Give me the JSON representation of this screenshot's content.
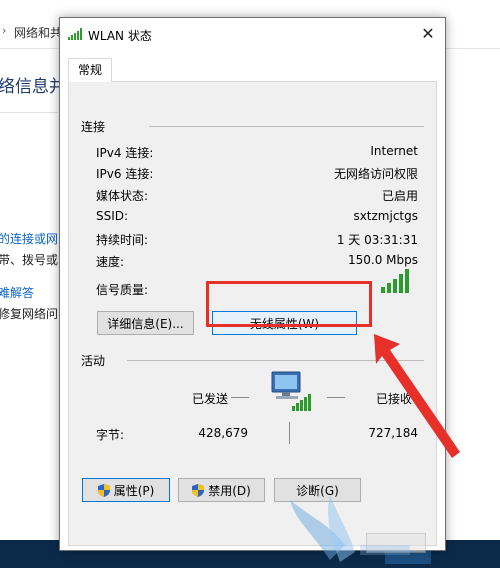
{
  "background_window": {
    "breadcrumb": "网络和共",
    "heading": "络信息并设",
    "links": [
      "的连接或网",
      "带、拨号或",
      "难解答",
      "修复网络问"
    ]
  },
  "dialog": {
    "title": "WLAN 状态",
    "tab_label": "常规",
    "connection": {
      "section_label": "连接",
      "rows": [
        {
          "label": "IPv4 连接:",
          "value": "Internet"
        },
        {
          "label": "IPv6 连接:",
          "value": "无网络访问权限"
        },
        {
          "label": "媒体状态:",
          "value": "已启用"
        },
        {
          "label": "SSID:",
          "value": "sxtzmjctgs"
        },
        {
          "label": "持续时间:",
          "value": "1 天 03:31:31"
        },
        {
          "label": "速度:",
          "value": "150.0 Mbps"
        }
      ],
      "signal_label": "信号质量:",
      "signal_level": 5,
      "details_button": "详细信息(E)...",
      "wireless_props_button": "无线属性(W)"
    },
    "activity": {
      "section_label": "活动",
      "sent_label": "已发送",
      "received_label": "已接收",
      "bytes_label": "字节:",
      "bytes_sent": "428,679",
      "bytes_received": "727,184"
    },
    "buttons": {
      "properties": "属性(P)",
      "disable": "禁用(D)",
      "diagnose": "诊断(G)"
    }
  },
  "colors": {
    "highlight": "#e8302a",
    "signal_green": "#2e9b2e",
    "accent_blue": "#0078d7"
  }
}
